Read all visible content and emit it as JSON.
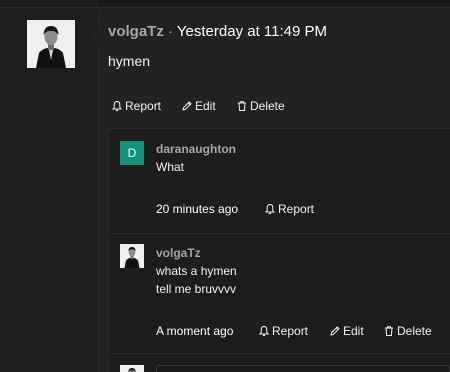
{
  "post": {
    "author": "volgaTz",
    "separator": "·",
    "time": "Yesterday at 11:49 PM",
    "body": "hymen",
    "actions": {
      "report": "Report",
      "edit": "Edit",
      "delete": "Delete"
    }
  },
  "comments": [
    {
      "avatar_letter": "D",
      "avatar_color": "#129079",
      "author": "daranaughton",
      "lines": [
        "What"
      ],
      "time": "20 minutes ago",
      "actions": {
        "report": "Report"
      }
    },
    {
      "author": "volgaTz",
      "lines": [
        "whats a hymen",
        "tell me bruvvvv"
      ],
      "time": "A moment ago",
      "actions": {
        "report": "Report",
        "edit": "Edit",
        "delete": "Delete"
      }
    }
  ],
  "icons": {
    "report": "bell-icon",
    "edit": "pencil-icon",
    "delete": "trash-icon"
  }
}
